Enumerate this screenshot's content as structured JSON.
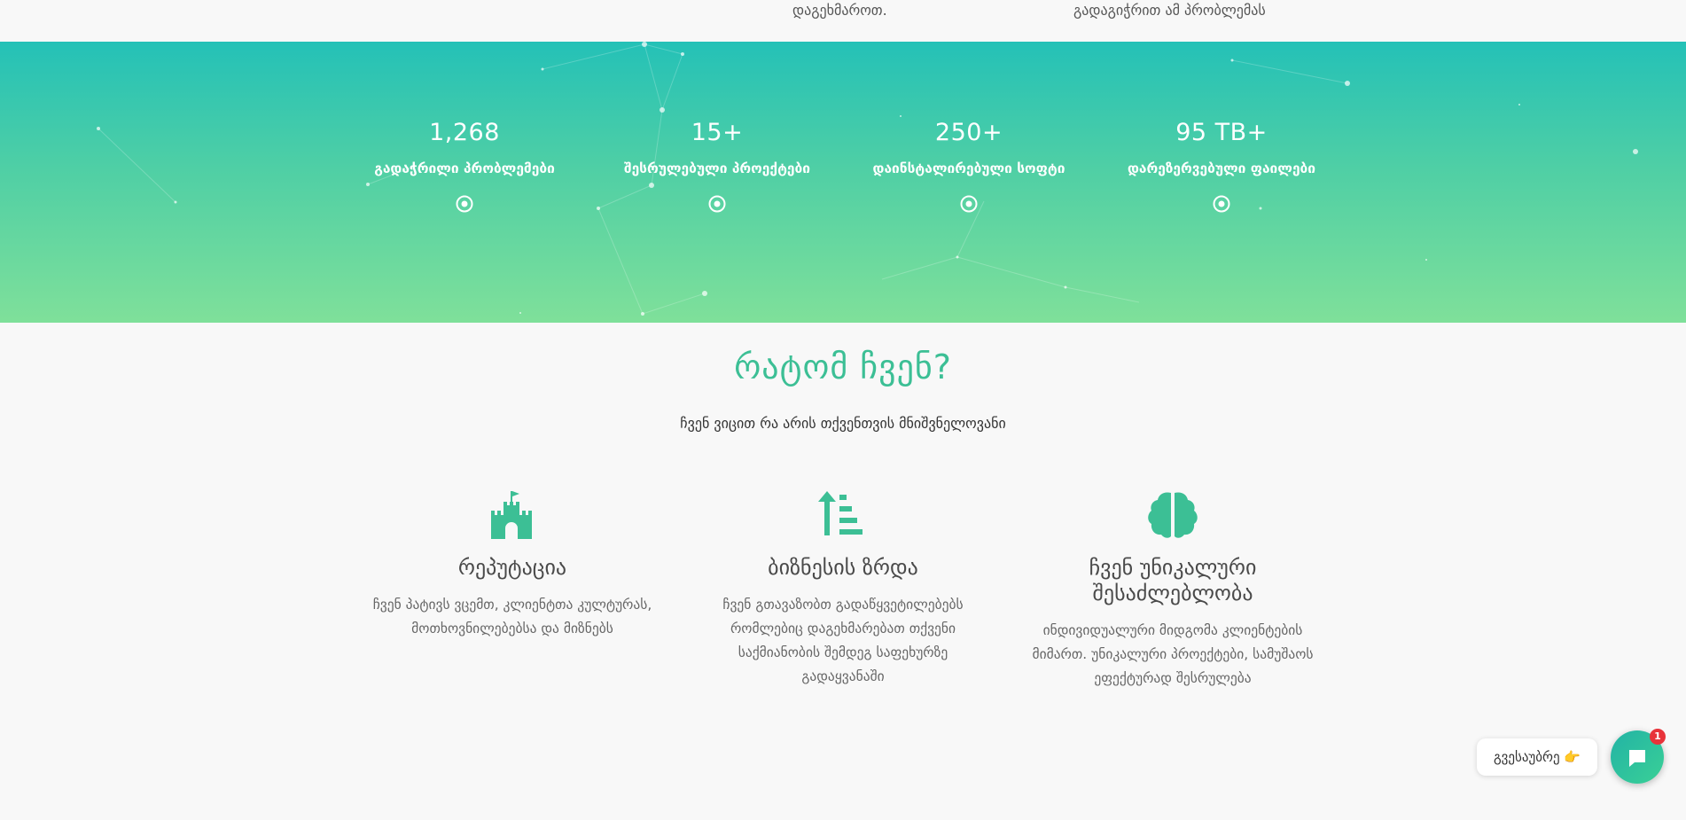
{
  "top_strip": {
    "left_text": "დაგეხმაროთ.",
    "right_text": "გადაგიჭრით ამ პრობლემას"
  },
  "stats": [
    {
      "number": "1,268",
      "label": "გადაჭრილი პრობლემები"
    },
    {
      "number": "15+",
      "label": "შესრულებული პროექტები"
    },
    {
      "number": "250+",
      "label": "დაინსტალირებული სოფტი"
    },
    {
      "number": "95 TB+",
      "label": "დარეზერვებული ფაილები"
    }
  ],
  "why": {
    "title": "რატომ ჩვენ?",
    "subtitle": "ჩვენ ვიცით რა არის თქვენთვის მნიშვნელოვანი",
    "features": [
      {
        "icon": "castle-icon",
        "title": "რეპუტაცია",
        "description": "ჩვენ პატივს ვცემთ, კლიენტთა კულტურას, მოთხოვნილებებსა და მიზნებს"
      },
      {
        "icon": "growth-icon",
        "title": "ბიზნესის ზრდა",
        "description": "ჩვენ გთავაზობთ გადაწყვეტილებებს რომლებიც დაგეხმარებათ თქვენი საქმიანობის შემდეგ საფეხურზე გადაყვანაში"
      },
      {
        "icon": "brain-icon",
        "title": "ჩვენ უნიკალური შესაძლებლობა",
        "description": "ინდივიდუალური მიდგომა კლიენტების მიმართ. უნიკალური პროექტები, სამუშაოს ეფექტურად შესრულება"
      }
    ]
  },
  "chat": {
    "prompt": "გვესაუბრე 👉",
    "badge_count": "1"
  },
  "colors": {
    "accent": "#3cbf95",
    "band_top": "#24c1b7",
    "band_bottom": "#7fe09a",
    "badge": "#e8333a"
  }
}
